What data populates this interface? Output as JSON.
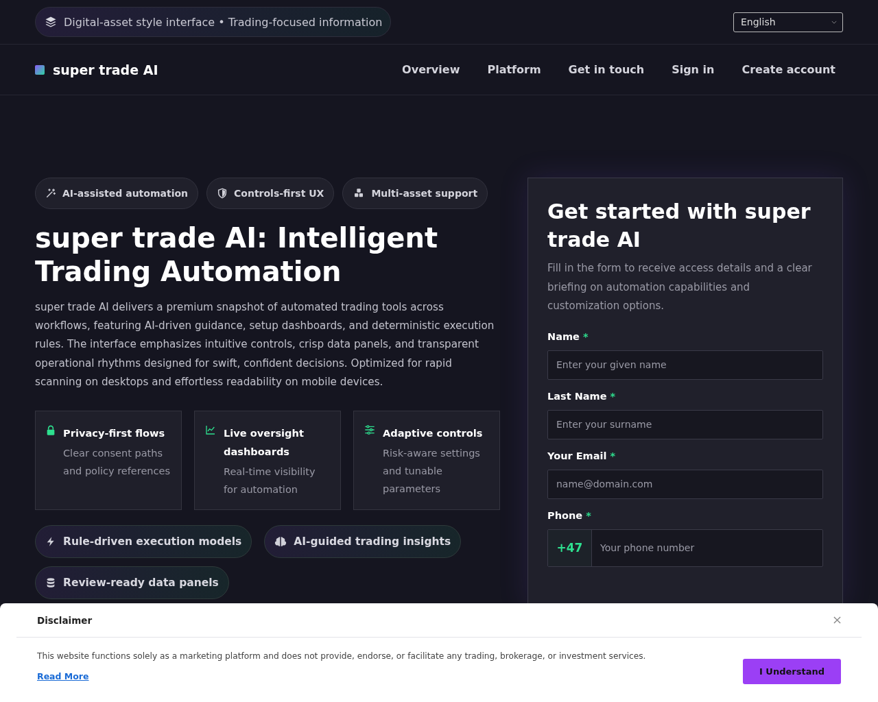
{
  "top_bar": {
    "badge": "Digital-asset style interface • Trading-focused information",
    "language": "English"
  },
  "nav": {
    "brand": "super trade AI",
    "links": [
      "Overview",
      "Platform",
      "Get in touch",
      "Sign in",
      "Create account"
    ]
  },
  "hero": {
    "chips": [
      "AI-assisted automation",
      "Controls-first UX",
      "Multi-asset support"
    ],
    "title": "super trade AI: Intelligent Trading Automation",
    "text": "super trade AI delivers a premium snapshot of automated trading tools across workflows, featuring AI-driven guidance, setup dashboards, and deterministic execution rules. The interface emphasizes intuitive controls, crisp data panels, and transparent operational rhythms designed for swift, confident decisions. Optimized for rapid scanning on desktops and effortless readability on mobile devices.",
    "features": [
      {
        "title": "Privacy-first flows",
        "text": "Clear consent paths and policy references"
      },
      {
        "title": "Live oversight dashboards",
        "text": "Real-time visibility for automation"
      },
      {
        "title": "Adaptive controls",
        "text": "Risk-aware settings and tunable parameters"
      }
    ],
    "tags": [
      "Rule-driven execution models",
      "AI-guided trading insights",
      "Review-ready data panels"
    ]
  },
  "form": {
    "title": "Get started with super trade AI",
    "intro": "Fill in the form to receive access details and a clear briefing on automation capabilities and customization options.",
    "fields": [
      {
        "label": "Name",
        "required": "*",
        "placeholder": "Enter your given name",
        "kind": "text"
      },
      {
        "label": "Last Name",
        "required": "*",
        "placeholder": "Enter your surname",
        "kind": "text"
      },
      {
        "label": "Your Email",
        "required": "*",
        "placeholder": "name@domain.com",
        "kind": "text"
      },
      {
        "label": "Phone",
        "required": "*",
        "placeholder": "Your phone number",
        "kind": "phone",
        "prefix": "+47"
      }
    ]
  },
  "disclaimer": {
    "title": "Disclaimer",
    "text": "This website functions solely as a marketing platform and does not provide, endorse, or facilitate any trading, brokerage, or investment services.",
    "link": "Read More",
    "button": "I Understand"
  }
}
